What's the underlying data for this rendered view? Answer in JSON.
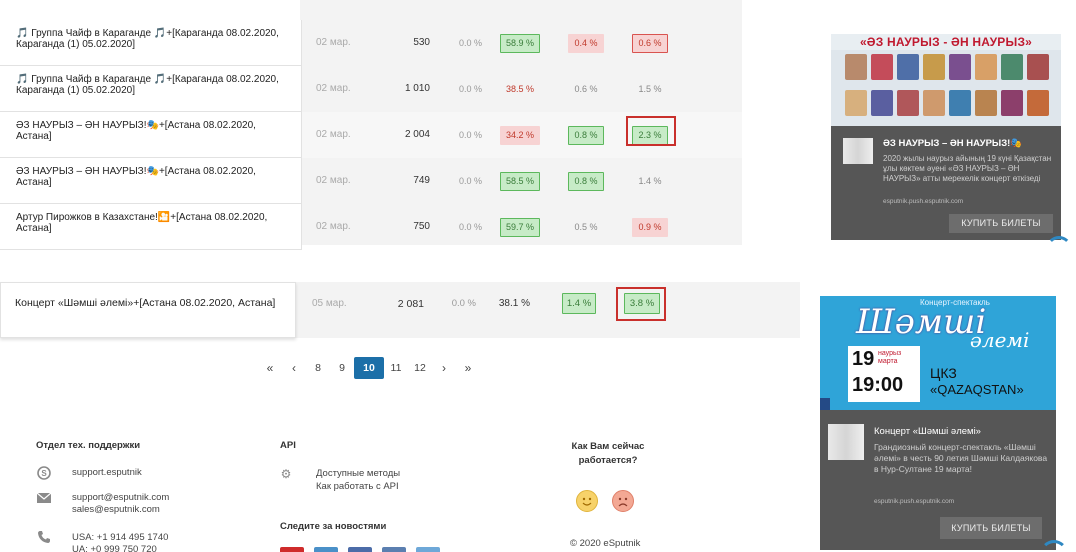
{
  "top_rows": [
    {
      "name": "🎵 Группа Чайф в Караганде 🎵+[Караганда 08.02.2020, Караганда (1) 05.02.2020]",
      "date": "02 мар.",
      "count": "530",
      "pct0": "0.0 %",
      "c1": "58.9 %",
      "c2": "0.4 %",
      "c3": "0.6 %"
    },
    {
      "name": "🎵 Группа Чайф в Караганде 🎵+[Караганда 08.02.2020, Караганда (1) 05.02.2020]",
      "date": "02 мар.",
      "count": "1 010",
      "pct0": "0.0 %",
      "c1": "38.5 %",
      "c2": "0.6 %",
      "c3": "1.5 %"
    },
    {
      "name": "ӘЗ НАУРЫЗ – ӘН НАУРЫЗ!🎭+[Астана 08.02.2020, Астана]",
      "date": "02 мар.",
      "count": "2 004",
      "pct0": "0.0 %",
      "c1": "34.2 %",
      "c2": "0.8 %",
      "c3": "2.3 %"
    },
    {
      "name": "ӘЗ НАУРЫЗ – ӘН НАУРЫЗ!🎭+[Астана 08.02.2020, Астана]",
      "date": "02 мар.",
      "count": "749",
      "pct0": "0.0 %",
      "c1": "58.5 %",
      "c2": "0.8 %",
      "c3": "1.4 %"
    },
    {
      "name": "Артур Пирожков в Казахстане!🎦+[Астана 08.02.2020, Астана]",
      "date": "02 мар.",
      "count": "750",
      "pct0": "0.0 %",
      "c1": "59.7 %",
      "c2": "0.5 %",
      "c3": "0.9 %"
    }
  ],
  "lower_row": {
    "name": "Концерт «Шәмші әлемі»+[Астана 08.02.2020, Астана]",
    "date": "05 мар.",
    "count": "2 081",
    "pct0": "0.0 %",
    "pct1": "38.1 %",
    "c1": "1.4 %",
    "c2": "3.8 %"
  },
  "pagination": {
    "first": "«",
    "prev": "‹",
    "pages": [
      "8",
      "9",
      "10",
      "11",
      "12"
    ],
    "active": "10",
    "next": "›",
    "last": "»"
  },
  "footer": {
    "support_title": "Отдел тех. поддержки",
    "skype": "support.esputnik",
    "email1": "support@esputnik.com",
    "email2": "sales@esputnik.com",
    "phone1": "USA: +1 914 495 1740",
    "phone2": "UA: +0 999 750 720",
    "api_title": "API",
    "api_link1": "Доступные методы",
    "api_link2": "Как работать с API",
    "news_title": "Следите за новостями",
    "mood_title": "Как Вам сейчас работается?",
    "copyright": "© 2020 eSputnik"
  },
  "ad1": {
    "banner_title": "«ӘЗ НАУРЫЗ - ӘН НАУРЫЗ»",
    "title": "ӘЗ НАУРЫЗ – ӘН НАУРЫЗ!🎭",
    "body": "2020 жылы наурыз айының 19 күні Қазақстан ұлы көктем әуені «ӘЗ НАУРЫЗ – ӘН НАУРЫЗ» атты мерекелік концерт өткізеді",
    "url": "esputnik.push.esputnik.com",
    "button": "КУПИТЬ БИЛЕТЫ"
  },
  "ad2": {
    "banner_top": "Концерт-спектакль",
    "script1": "Шәмші",
    "script2": "әлемі",
    "day": "19",
    "month": "наурыз марта",
    "time": "19:00",
    "venue1": "ЦКЗ",
    "venue2": "«QAZAQSTAN»",
    "title": "Концерт «Шәмші әлемі»",
    "body": "Грандиозный концерт-спектакль «Шәмші әлемі» в честь 90 летия Шәмші Калдаякова в Нур-Султане 19 марта!",
    "url": "esputnik.push.esputnik.com",
    "button": "КУПИТЬ БИЛЕТЫ"
  },
  "colors": {
    "accent": "#1c6fa8",
    "green": "#c7ebc7",
    "red": "#f7d3d3",
    "highlight": "#c9302c"
  }
}
